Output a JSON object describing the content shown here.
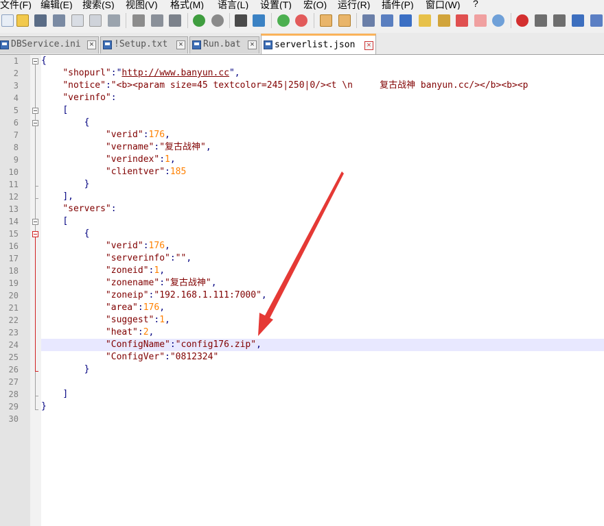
{
  "menu": [
    "文件(F)",
    "编辑(E)",
    "搜索(S)",
    "视图(V)",
    "格式(M)",
    "语言(L)",
    "设置(T)",
    "宏(O)",
    "运行(R)",
    "插件(P)",
    "窗口(W)",
    "?"
  ],
  "toolbar_icons": [
    "new-file-icon",
    "open-file-icon",
    "save-icon",
    "save-all-icon",
    "close-icon",
    "close-all-icon",
    "print-icon",
    "cut-icon",
    "copy-icon",
    "paste-icon",
    "undo-icon",
    "redo-icon",
    "find-icon",
    "replace-icon",
    "zoom-in-icon",
    "zoom-out-icon",
    "sync-vertical-icon",
    "sync-horizontal-icon",
    "word-wrap-icon",
    "show-all-chars-icon",
    "indent-guide-icon",
    "user-language-icon",
    "doc-map-icon",
    "function-list-icon",
    "folder-workspace-icon",
    "monitor-icon",
    "record-macro-icon",
    "stop-macro-icon",
    "play-macro-icon",
    "run-macro-multiple-icon"
  ],
  "tabs": [
    {
      "label": "DBService.ini",
      "active": false
    },
    {
      "label": "!Setup.txt",
      "active": false
    },
    {
      "label": "Run.bat",
      "active": false
    },
    {
      "label": "serverlist.json",
      "active": true
    }
  ],
  "colors": {
    "accent_tab": "#fab35a",
    "string": "#800000",
    "number": "#ff8000",
    "operator": "#000080",
    "arrow": "#e53935"
  },
  "line_numbers": [
    "1",
    "2",
    "3",
    "4",
    "5",
    "6",
    "7",
    "8",
    "9",
    "10",
    "11",
    "12",
    "13",
    "14",
    "15",
    "16",
    "17",
    "18",
    "19",
    "20",
    "21",
    "22",
    "23",
    "24",
    "25",
    "26",
    "27",
    "28",
    "29",
    "30"
  ],
  "code": {
    "l1": "{",
    "l2_key": "\"shopurl\"",
    "l2_url": "http://www.banyun.cc",
    "l3_key": "\"notice\"",
    "l3_val": "\"<b><param size=45 textcolor=245|250|0/><t \\n     复古战神 banyun.cc/></b><b><p",
    "l4_key": "\"verinfo\"",
    "l5": "[",
    "l6": "{",
    "l7_key": "\"verid\"",
    "l7_val": "176",
    "l8_key": "\"vername\"",
    "l8_val": "\"复古战神\"",
    "l9_key": "\"verindex\"",
    "l9_val": "1",
    "l10_key": "\"clientver\"",
    "l10_val": "185",
    "l11": "}",
    "l12": "],",
    "l13_key": "\"servers\"",
    "l14": "[",
    "l15": "{",
    "l16_key": "\"verid\"",
    "l16_val": "176",
    "l17_key": "\"serverinfo\"",
    "l17_val": "\"\"",
    "l18_key": "\"zoneid\"",
    "l18_val": "1",
    "l19_key": "\"zonename\"",
    "l19_val": "\"复古战神\"",
    "l20_key": "\"zoneip\"",
    "l20_val": "\"192.168.1.111:7000\"",
    "l21_key": "\"area\"",
    "l21_val": "176",
    "l22_key": "\"suggest\"",
    "l22_val": "1",
    "l23_key": "\"heat\"",
    "l23_val": "2",
    "l24_key": "\"ConfigName\"",
    "l24_val": "\"config176.zip\"",
    "l25_key": "\"ConfigVer\"",
    "l25_val": "\"0812324\"",
    "l26": "}",
    "l28": "]",
    "l29": "}"
  }
}
